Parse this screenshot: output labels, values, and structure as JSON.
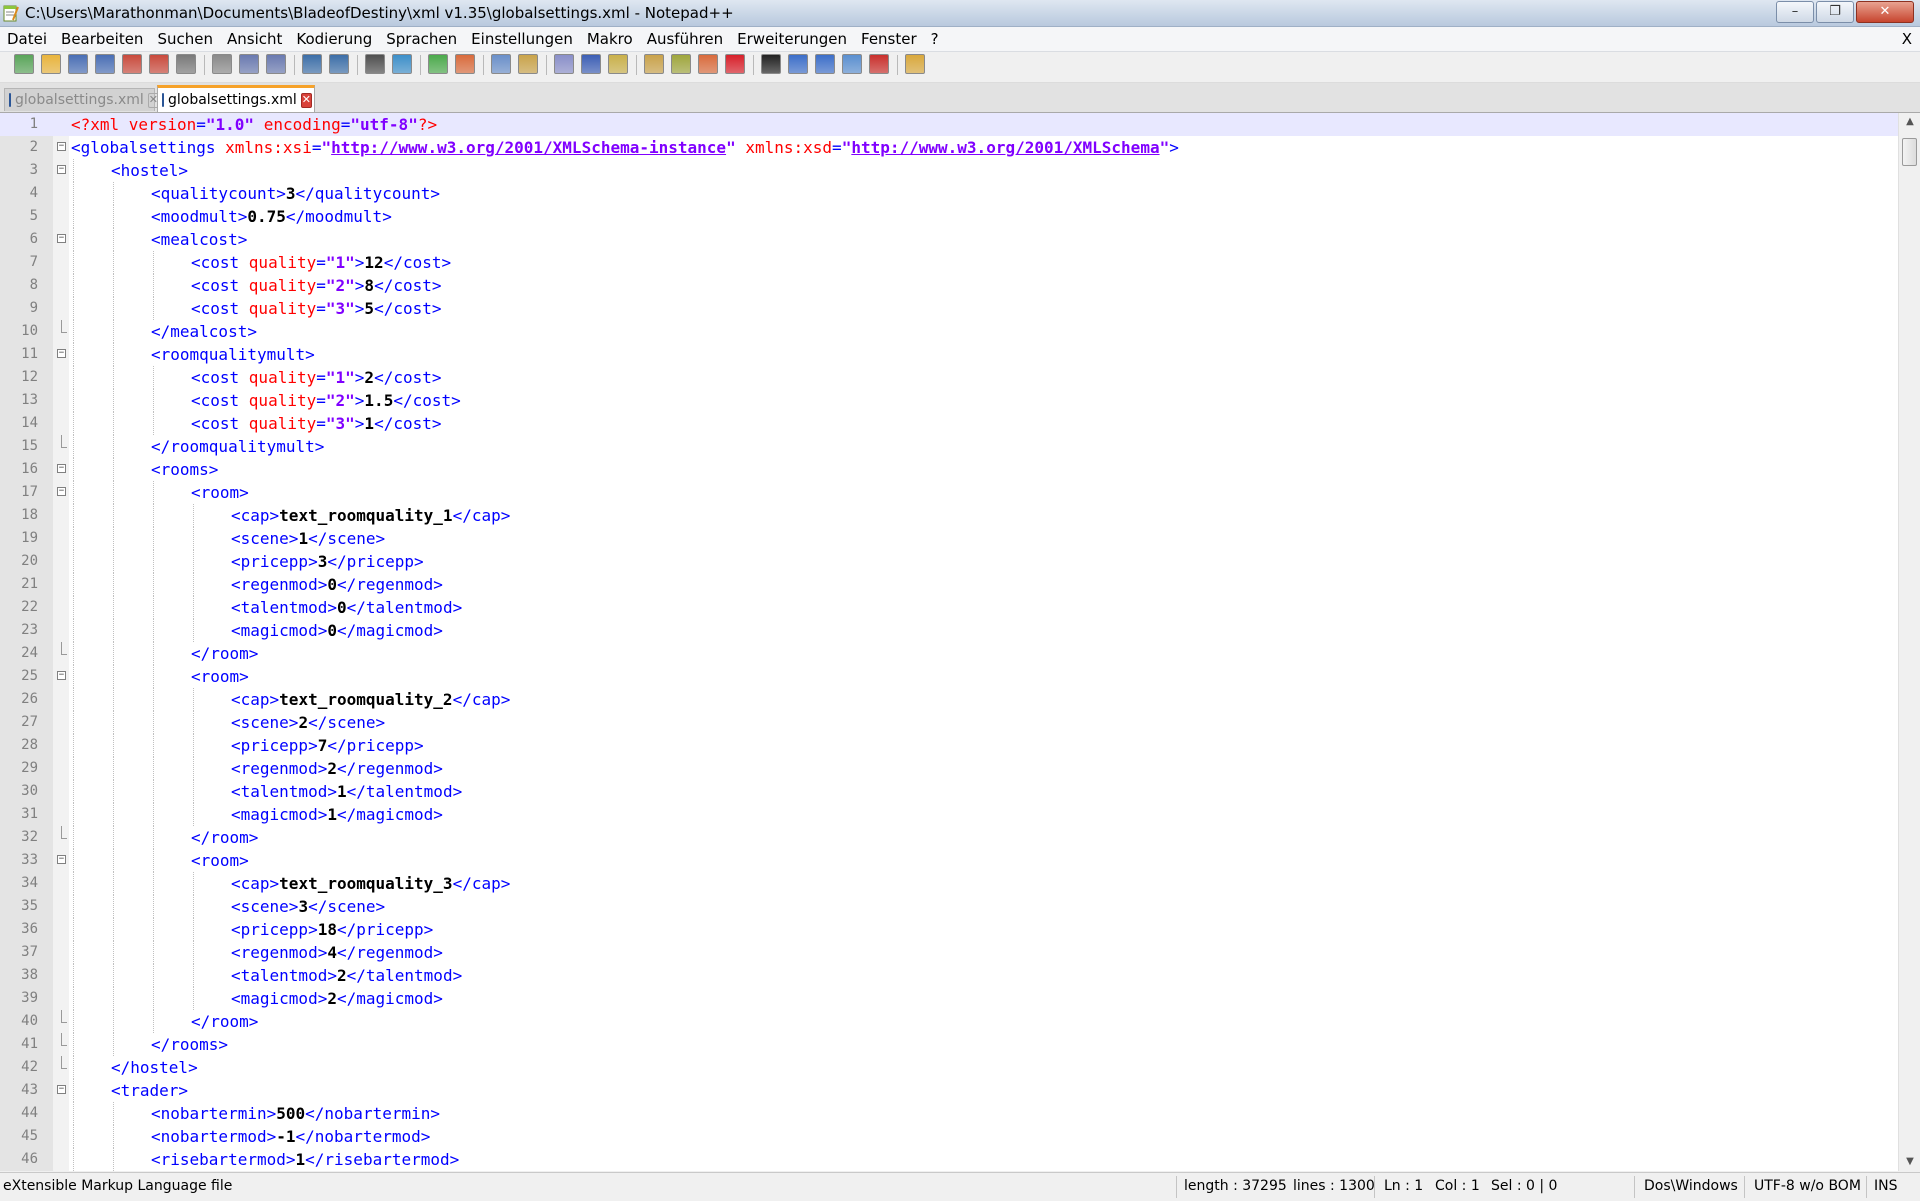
{
  "window": {
    "title": "C:\\Users\\Marathonman\\Documents\\BladeofDestiny\\xml v1.35\\globalsettings.xml - Notepad++",
    "minimize_label": "–",
    "maximize_label": "❐",
    "close_label": "✕"
  },
  "menu": {
    "items": [
      "Datei",
      "Bearbeiten",
      "Suchen",
      "Ansicht",
      "Kodierung",
      "Sprachen",
      "Einstellungen",
      "Makro",
      "Ausführen",
      "Erweiterungen",
      "Fenster",
      "?"
    ],
    "close_label": "X"
  },
  "toolbar": {
    "buttons": [
      "new-file-icon",
      "open-file-icon",
      "save-icon",
      "save-all-icon",
      "close-icon",
      "close-all-icon",
      "print-icon",
      "cut-icon",
      "copy-icon",
      "paste-icon",
      "undo-icon",
      "redo-icon",
      "find-icon",
      "replace-icon",
      "zoom-in-icon",
      "zoom-out-icon",
      "sync-vertical-icon",
      "sync-horizontal-icon",
      "word-wrap-icon",
      "show-all-characters-icon",
      "indent-guide-icon",
      "user-defined-language-icon",
      "document-map-icon",
      "function-list-icon",
      "record-macro-icon",
      "stop-recording-icon",
      "playback-macro-icon",
      "run-macro-multiple-icon",
      "save-macro-icon",
      "spell-check-icon",
      "launch-in-browser-icon"
    ]
  },
  "tabs": [
    {
      "label": "globalsettings.xml",
      "active": false
    },
    {
      "label": "globalsettings.xml",
      "active": true
    }
  ],
  "editor": {
    "current_line": 1,
    "lines": [
      {
        "n": "1",
        "indent": 0,
        "fold": "none",
        "parts": [
          [
            "pi",
            "<?xml "
          ],
          [
            "attr",
            "version"
          ],
          [
            "tag",
            "="
          ],
          [
            "val",
            "\"1.0\""
          ],
          [
            "tag",
            " "
          ],
          [
            "attr",
            "encoding"
          ],
          [
            "tag",
            "="
          ],
          [
            "val",
            "\"utf-8\""
          ],
          [
            "pi",
            "?>"
          ]
        ]
      },
      {
        "n": "2",
        "indent": 0,
        "fold": "open",
        "parts": [
          [
            "tag",
            "<globalsettings "
          ],
          [
            "attr",
            "xmlns:xsi"
          ],
          [
            "tag",
            "="
          ],
          [
            "val",
            "\""
          ],
          [
            "url",
            "http://www.w3.org/2001/XMLSchema-instance"
          ],
          [
            "val",
            "\""
          ],
          [
            "tag",
            " "
          ],
          [
            "attr",
            "xmlns:xsd"
          ],
          [
            "tag",
            "="
          ],
          [
            "val",
            "\""
          ],
          [
            "url",
            "http://www.w3.org/2001/XMLSchema"
          ],
          [
            "val",
            "\""
          ],
          [
            "tag",
            ">"
          ]
        ]
      },
      {
        "n": "3",
        "indent": 1,
        "fold": "open",
        "parts": [
          [
            "tag",
            "<hostel>"
          ]
        ]
      },
      {
        "n": "4",
        "indent": 2,
        "fold": "none",
        "parts": [
          [
            "tag",
            "<qualitycount>"
          ],
          [
            "txt",
            "3"
          ],
          [
            "tag",
            "</qualitycount>"
          ]
        ]
      },
      {
        "n": "5",
        "indent": 2,
        "fold": "none",
        "parts": [
          [
            "tag",
            "<moodmult>"
          ],
          [
            "txt",
            "0.75"
          ],
          [
            "tag",
            "</moodmult>"
          ]
        ]
      },
      {
        "n": "6",
        "indent": 2,
        "fold": "open",
        "parts": [
          [
            "tag",
            "<mealcost>"
          ]
        ]
      },
      {
        "n": "7",
        "indent": 3,
        "fold": "none",
        "parts": [
          [
            "tag",
            "<cost "
          ],
          [
            "attr",
            "quality"
          ],
          [
            "tag",
            "="
          ],
          [
            "val",
            "\"1\""
          ],
          [
            "tag",
            ">"
          ],
          [
            "txt",
            "12"
          ],
          [
            "tag",
            "</cost>"
          ]
        ]
      },
      {
        "n": "8",
        "indent": 3,
        "fold": "none",
        "parts": [
          [
            "tag",
            "<cost "
          ],
          [
            "attr",
            "quality"
          ],
          [
            "tag",
            "="
          ],
          [
            "val",
            "\"2\""
          ],
          [
            "tag",
            ">"
          ],
          [
            "txt",
            "8"
          ],
          [
            "tag",
            "</cost>"
          ]
        ]
      },
      {
        "n": "9",
        "indent": 3,
        "fold": "none",
        "parts": [
          [
            "tag",
            "<cost "
          ],
          [
            "attr",
            "quality"
          ],
          [
            "tag",
            "="
          ],
          [
            "val",
            "\"3\""
          ],
          [
            "tag",
            ">"
          ],
          [
            "txt",
            "5"
          ],
          [
            "tag",
            "</cost>"
          ]
        ]
      },
      {
        "n": "10",
        "indent": 2,
        "fold": "end",
        "parts": [
          [
            "tag",
            "</mealcost>"
          ]
        ]
      },
      {
        "n": "11",
        "indent": 2,
        "fold": "open",
        "parts": [
          [
            "tag",
            "<roomqualitymult>"
          ]
        ]
      },
      {
        "n": "12",
        "indent": 3,
        "fold": "none",
        "parts": [
          [
            "tag",
            "<cost "
          ],
          [
            "attr",
            "quality"
          ],
          [
            "tag",
            "="
          ],
          [
            "val",
            "\"1\""
          ],
          [
            "tag",
            ">"
          ],
          [
            "txt",
            "2"
          ],
          [
            "tag",
            "</cost>"
          ]
        ]
      },
      {
        "n": "13",
        "indent": 3,
        "fold": "none",
        "parts": [
          [
            "tag",
            "<cost "
          ],
          [
            "attr",
            "quality"
          ],
          [
            "tag",
            "="
          ],
          [
            "val",
            "\"2\""
          ],
          [
            "tag",
            ">"
          ],
          [
            "txt",
            "1.5"
          ],
          [
            "tag",
            "</cost>"
          ]
        ]
      },
      {
        "n": "14",
        "indent": 3,
        "fold": "none",
        "parts": [
          [
            "tag",
            "<cost "
          ],
          [
            "attr",
            "quality"
          ],
          [
            "tag",
            "="
          ],
          [
            "val",
            "\"3\""
          ],
          [
            "tag",
            ">"
          ],
          [
            "txt",
            "1"
          ],
          [
            "tag",
            "</cost>"
          ]
        ]
      },
      {
        "n": "15",
        "indent": 2,
        "fold": "end",
        "parts": [
          [
            "tag",
            "</roomqualitymult>"
          ]
        ]
      },
      {
        "n": "16",
        "indent": 2,
        "fold": "open",
        "parts": [
          [
            "tag",
            "<rooms>"
          ]
        ]
      },
      {
        "n": "17",
        "indent": 3,
        "fold": "open",
        "parts": [
          [
            "tag",
            "<room>"
          ]
        ]
      },
      {
        "n": "18",
        "indent": 4,
        "fold": "none",
        "parts": [
          [
            "tag",
            "<cap>"
          ],
          [
            "txt",
            "text_roomquality_1"
          ],
          [
            "tag",
            "</cap>"
          ]
        ]
      },
      {
        "n": "19",
        "indent": 4,
        "fold": "none",
        "parts": [
          [
            "tag",
            "<scene>"
          ],
          [
            "txt",
            "1"
          ],
          [
            "tag",
            "</scene>"
          ]
        ]
      },
      {
        "n": "20",
        "indent": 4,
        "fold": "none",
        "parts": [
          [
            "tag",
            "<pricepp>"
          ],
          [
            "txt",
            "3"
          ],
          [
            "tag",
            "</pricepp>"
          ]
        ]
      },
      {
        "n": "21",
        "indent": 4,
        "fold": "none",
        "parts": [
          [
            "tag",
            "<regenmod>"
          ],
          [
            "txt",
            "0"
          ],
          [
            "tag",
            "</regenmod>"
          ]
        ]
      },
      {
        "n": "22",
        "indent": 4,
        "fold": "none",
        "parts": [
          [
            "tag",
            "<talentmod>"
          ],
          [
            "txt",
            "0"
          ],
          [
            "tag",
            "</talentmod>"
          ]
        ]
      },
      {
        "n": "23",
        "indent": 4,
        "fold": "none",
        "parts": [
          [
            "tag",
            "<magicmod>"
          ],
          [
            "txt",
            "0"
          ],
          [
            "tag",
            "</magicmod>"
          ]
        ]
      },
      {
        "n": "24",
        "indent": 3,
        "fold": "end",
        "parts": [
          [
            "tag",
            "</room>"
          ]
        ]
      },
      {
        "n": "25",
        "indent": 3,
        "fold": "open",
        "parts": [
          [
            "tag",
            "<room>"
          ]
        ]
      },
      {
        "n": "26",
        "indent": 4,
        "fold": "none",
        "parts": [
          [
            "tag",
            "<cap>"
          ],
          [
            "txt",
            "text_roomquality_2"
          ],
          [
            "tag",
            "</cap>"
          ]
        ]
      },
      {
        "n": "27",
        "indent": 4,
        "fold": "none",
        "parts": [
          [
            "tag",
            "<scene>"
          ],
          [
            "txt",
            "2"
          ],
          [
            "tag",
            "</scene>"
          ]
        ]
      },
      {
        "n": "28",
        "indent": 4,
        "fold": "none",
        "parts": [
          [
            "tag",
            "<pricepp>"
          ],
          [
            "txt",
            "7"
          ],
          [
            "tag",
            "</pricepp>"
          ]
        ]
      },
      {
        "n": "29",
        "indent": 4,
        "fold": "none",
        "parts": [
          [
            "tag",
            "<regenmod>"
          ],
          [
            "txt",
            "2"
          ],
          [
            "tag",
            "</regenmod>"
          ]
        ]
      },
      {
        "n": "30",
        "indent": 4,
        "fold": "none",
        "parts": [
          [
            "tag",
            "<talentmod>"
          ],
          [
            "txt",
            "1"
          ],
          [
            "tag",
            "</talentmod>"
          ]
        ]
      },
      {
        "n": "31",
        "indent": 4,
        "fold": "none",
        "parts": [
          [
            "tag",
            "<magicmod>"
          ],
          [
            "txt",
            "1"
          ],
          [
            "tag",
            "</magicmod>"
          ]
        ]
      },
      {
        "n": "32",
        "indent": 3,
        "fold": "end",
        "parts": [
          [
            "tag",
            "</room>"
          ]
        ]
      },
      {
        "n": "33",
        "indent": 3,
        "fold": "open",
        "parts": [
          [
            "tag",
            "<room>"
          ]
        ]
      },
      {
        "n": "34",
        "indent": 4,
        "fold": "none",
        "parts": [
          [
            "tag",
            "<cap>"
          ],
          [
            "txt",
            "text_roomquality_3"
          ],
          [
            "tag",
            "</cap>"
          ]
        ]
      },
      {
        "n": "35",
        "indent": 4,
        "fold": "none",
        "parts": [
          [
            "tag",
            "<scene>"
          ],
          [
            "txt",
            "3"
          ],
          [
            "tag",
            "</scene>"
          ]
        ]
      },
      {
        "n": "36",
        "indent": 4,
        "fold": "none",
        "parts": [
          [
            "tag",
            "<pricepp>"
          ],
          [
            "txt",
            "18"
          ],
          [
            "tag",
            "</pricepp>"
          ]
        ]
      },
      {
        "n": "37",
        "indent": 4,
        "fold": "none",
        "parts": [
          [
            "tag",
            "<regenmod>"
          ],
          [
            "txt",
            "4"
          ],
          [
            "tag",
            "</regenmod>"
          ]
        ]
      },
      {
        "n": "38",
        "indent": 4,
        "fold": "none",
        "parts": [
          [
            "tag",
            "<talentmod>"
          ],
          [
            "txt",
            "2"
          ],
          [
            "tag",
            "</talentmod>"
          ]
        ]
      },
      {
        "n": "39",
        "indent": 4,
        "fold": "none",
        "parts": [
          [
            "tag",
            "<magicmod>"
          ],
          [
            "txt",
            "2"
          ],
          [
            "tag",
            "</magicmod>"
          ]
        ]
      },
      {
        "n": "40",
        "indent": 3,
        "fold": "end",
        "parts": [
          [
            "tag",
            "</room>"
          ]
        ]
      },
      {
        "n": "41",
        "indent": 2,
        "fold": "end",
        "parts": [
          [
            "tag",
            "</rooms>"
          ]
        ]
      },
      {
        "n": "42",
        "indent": 1,
        "fold": "end",
        "parts": [
          [
            "tag",
            "</hostel>"
          ]
        ]
      },
      {
        "n": "43",
        "indent": 1,
        "fold": "open",
        "parts": [
          [
            "tag",
            "<trader>"
          ]
        ]
      },
      {
        "n": "44",
        "indent": 2,
        "fold": "none",
        "parts": [
          [
            "tag",
            "<nobartermin>"
          ],
          [
            "txt",
            "500"
          ],
          [
            "tag",
            "</nobartermin>"
          ]
        ]
      },
      {
        "n": "45",
        "indent": 2,
        "fold": "none",
        "parts": [
          [
            "tag",
            "<nobartermod>"
          ],
          [
            "txt",
            "-1"
          ],
          [
            "tag",
            "</nobartermod>"
          ]
        ]
      },
      {
        "n": "46",
        "indent": 2,
        "fold": "none",
        "parts": [
          [
            "tag",
            "<risebartermod>"
          ],
          [
            "txt",
            "1"
          ],
          [
            "tag",
            "</risebartermod>"
          ]
        ]
      }
    ]
  },
  "statusbar": {
    "file_type": "eXtensible Markup Language file",
    "length": "length : 37295",
    "lines": "lines : 1300",
    "ln": "Ln : 1",
    "col": "Col : 1",
    "sel": "Sel : 0 | 0",
    "eol": "Dos\\Windows",
    "encoding": "UTF-8 w/o BOM",
    "mode": "INS"
  },
  "colors": {
    "tag": "#0000ff",
    "attribute": "#ff0000",
    "value": "#8000ff",
    "current_line": "#e8e8ff",
    "active_tab_accent": "#f6a22a"
  }
}
